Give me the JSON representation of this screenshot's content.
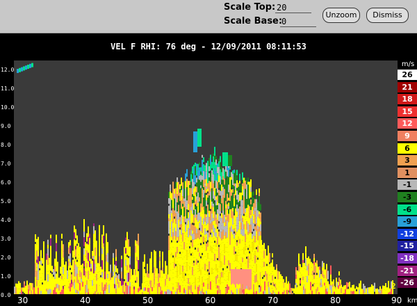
{
  "toolbar": {
    "scale_top_label": "Scale Top:",
    "scale_top_value": "20",
    "scale_base_label": "Scale Base:",
    "scale_base_value": "0",
    "unzoom_label": "Unzoom",
    "dismiss_label": "Dismiss"
  },
  "title": "VEL F  RHI: 76 deg  -  12/09/2011 08:11:53",
  "axes": {
    "y_ticks": [
      "12.0",
      "11.0",
      "10.0",
      "9.0",
      "8.0",
      "7.0",
      "6.0",
      "5.0",
      "4.0",
      "3.0",
      "2.0",
      "1.0",
      "0.0"
    ],
    "x_ticks": [
      "30",
      "40",
      "50",
      "60",
      "70",
      "80",
      "90"
    ],
    "x_unit": "km",
    "corner_value": "2"
  },
  "legend": {
    "unit": "m/s",
    "entries": [
      {
        "label": "26",
        "color": "#ffffff",
        "text": "#000000"
      },
      {
        "label": "21",
        "color": "#a00000",
        "text": "#ffffff"
      },
      {
        "label": "18",
        "color": "#d01818",
        "text": "#ffffff"
      },
      {
        "label": "15",
        "color": "#ee3030",
        "text": "#ffffff"
      },
      {
        "label": "12",
        "color": "#ff5a5a",
        "text": "#ffffff"
      },
      {
        "label": "9",
        "color": "#f08060",
        "text": "#ffffff"
      },
      {
        "label": "6",
        "color": "#ffff00",
        "text": "#000000"
      },
      {
        "label": "3",
        "color": "#f0a050",
        "text": "#000000"
      },
      {
        "label": "1",
        "color": "#e09060",
        "text": "#000000"
      },
      {
        "label": "-1",
        "color": "#b8b8b8",
        "text": "#000000"
      },
      {
        "label": "-3",
        "color": "#208020",
        "text": "#000000"
      },
      {
        "label": "-6",
        "color": "#00e08a",
        "text": "#000000"
      },
      {
        "label": "-9",
        "color": "#28a0d8",
        "text": "#000000"
      },
      {
        "label": "-12",
        "color": "#1040e0",
        "text": "#ffffff"
      },
      {
        "label": "-15",
        "color": "#2020a0",
        "text": "#ffffff"
      },
      {
        "label": "-18",
        "color": "#8030c0",
        "text": "#ffffff"
      },
      {
        "label": "-21",
        "color": "#a02080",
        "text": "#ffffff"
      },
      {
        "label": "-26",
        "color": "#600040",
        "text": "#ffffff"
      }
    ]
  }
}
